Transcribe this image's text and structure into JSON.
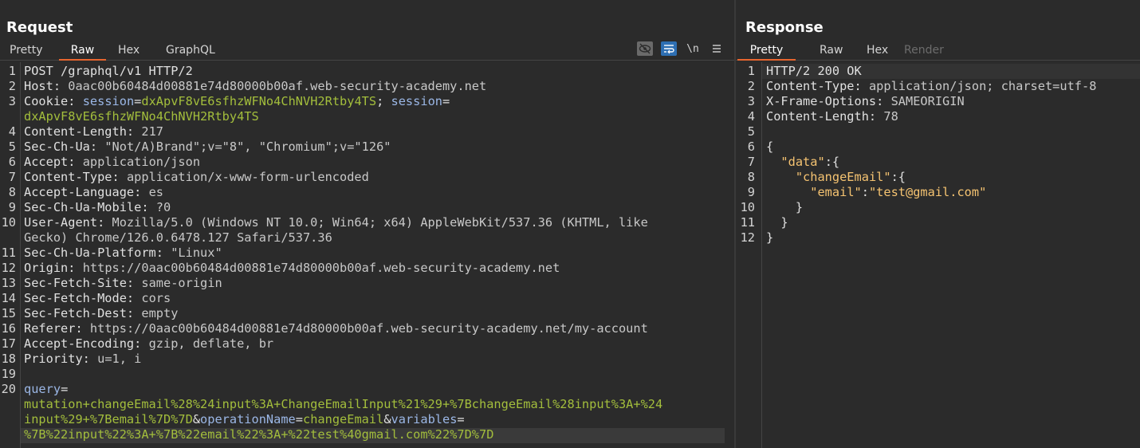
{
  "request": {
    "title": "Request",
    "tabs": [
      "Pretty",
      "Raw",
      "Hex",
      "GraphQL"
    ],
    "active_tab": "Raw",
    "toolbar": {
      "hide_icon": "eye-slash-icon",
      "wrap_icon": "wrap-icon",
      "newline_label": "\\n",
      "menu_icon": "menu-icon"
    },
    "lines": [
      {
        "n": "1",
        "parts": [
          {
            "t": "POST /graphql/v1 HTTP/2",
            "c": "hdr"
          }
        ]
      },
      {
        "n": "2",
        "parts": [
          {
            "t": "Host: ",
            "c": "hdr"
          },
          {
            "t": "0aac00b60484d00881e74d80000b00af.web-security-academy.net",
            "c": "val"
          }
        ]
      },
      {
        "n": "3",
        "parts": [
          {
            "t": "Cookie: ",
            "c": "hdr"
          },
          {
            "t": "session",
            "c": "blue"
          },
          {
            "t": "=",
            "c": "hdr"
          },
          {
            "t": "dxApvF8vE6sfhzWFNo4ChNVH2Rtby4TS",
            "c": "green"
          },
          {
            "t": "; ",
            "c": "hdr"
          },
          {
            "t": "session",
            "c": "blue"
          },
          {
            "t": "=",
            "c": "hdr"
          }
        ]
      },
      {
        "n": "",
        "parts": [
          {
            "t": "dxApvF8vE6sfhzWFNo4ChNVH2Rtby4TS",
            "c": "green"
          }
        ]
      },
      {
        "n": "4",
        "parts": [
          {
            "t": "Content-Length: ",
            "c": "hdr"
          },
          {
            "t": "217",
            "c": "val"
          }
        ]
      },
      {
        "n": "5",
        "parts": [
          {
            "t": "Sec-Ch-Ua: ",
            "c": "hdr"
          },
          {
            "t": "\"Not/A)Brand\";v=\"8\", \"Chromium\";v=\"126\"",
            "c": "val"
          }
        ]
      },
      {
        "n": "6",
        "parts": [
          {
            "t": "Accept: ",
            "c": "hdr"
          },
          {
            "t": "application/json",
            "c": "val"
          }
        ]
      },
      {
        "n": "7",
        "parts": [
          {
            "t": "Content-Type: ",
            "c": "hdr"
          },
          {
            "t": "application/x-www-form-urlencoded",
            "c": "val"
          }
        ]
      },
      {
        "n": "8",
        "parts": [
          {
            "t": "Accept-Language: ",
            "c": "hdr"
          },
          {
            "t": "es",
            "c": "val"
          }
        ]
      },
      {
        "n": "9",
        "parts": [
          {
            "t": "Sec-Ch-Ua-Mobile: ",
            "c": "hdr"
          },
          {
            "t": "?0",
            "c": "val"
          }
        ]
      },
      {
        "n": "10",
        "parts": [
          {
            "t": "User-Agent: ",
            "c": "hdr"
          },
          {
            "t": "Mozilla/5.0 (Windows NT 10.0; Win64; x64) AppleWebKit/537.36 (KHTML, like",
            "c": "val"
          }
        ]
      },
      {
        "n": "",
        "parts": [
          {
            "t": "Gecko) Chrome/126.0.6478.127 Safari/537.36",
            "c": "val"
          }
        ]
      },
      {
        "n": "11",
        "parts": [
          {
            "t": "Sec-Ch-Ua-Platform: ",
            "c": "hdr"
          },
          {
            "t": "\"Linux\"",
            "c": "val"
          }
        ]
      },
      {
        "n": "12",
        "parts": [
          {
            "t": "Origin: ",
            "c": "hdr"
          },
          {
            "t": "https://0aac00b60484d00881e74d80000b00af.web-security-academy.net",
            "c": "val"
          }
        ]
      },
      {
        "n": "13",
        "parts": [
          {
            "t": "Sec-Fetch-Site: ",
            "c": "hdr"
          },
          {
            "t": "same-origin",
            "c": "val"
          }
        ]
      },
      {
        "n": "14",
        "parts": [
          {
            "t": "Sec-Fetch-Mode: ",
            "c": "hdr"
          },
          {
            "t": "cors",
            "c": "val"
          }
        ]
      },
      {
        "n": "15",
        "parts": [
          {
            "t": "Sec-Fetch-Dest: ",
            "c": "hdr"
          },
          {
            "t": "empty",
            "c": "val"
          }
        ]
      },
      {
        "n": "16",
        "parts": [
          {
            "t": "Referer: ",
            "c": "hdr"
          },
          {
            "t": "https://0aac00b60484d00881e74d80000b00af.web-security-academy.net/my-account",
            "c": "val"
          }
        ]
      },
      {
        "n": "17",
        "parts": [
          {
            "t": "Accept-Encoding: ",
            "c": "hdr"
          },
          {
            "t": "gzip, deflate, br",
            "c": "val"
          }
        ]
      },
      {
        "n": "18",
        "parts": [
          {
            "t": "Priority: ",
            "c": "hdr"
          },
          {
            "t": "u=1, i",
            "c": "val"
          }
        ]
      },
      {
        "n": "19",
        "parts": []
      },
      {
        "n": "20",
        "parts": [
          {
            "t": "query",
            "c": "blue"
          },
          {
            "t": "=",
            "c": "hdr"
          }
        ]
      },
      {
        "n": "",
        "parts": [
          {
            "t": "mutation+changeEmail%28%24input%3A+ChangeEmailInput%21%29+%7BchangeEmail%28input%3A+%24",
            "c": "green"
          }
        ]
      },
      {
        "n": "",
        "parts": [
          {
            "t": "input%29+%7Bemail%7D%7D",
            "c": "green"
          },
          {
            "t": "&",
            "c": "hdr"
          },
          {
            "t": "operationName",
            "c": "blue"
          },
          {
            "t": "=",
            "c": "hdr"
          },
          {
            "t": "changeEmail",
            "c": "green"
          },
          {
            "t": "&",
            "c": "hdr"
          },
          {
            "t": "variables",
            "c": "blue"
          },
          {
            "t": "=",
            "c": "hdr"
          }
        ]
      },
      {
        "n": "",
        "parts": [
          {
            "t": "%7B%22input%22%3A+%7B%22email%22%3A+%22test%40gmail.com%22%7D%7D",
            "c": "green"
          }
        ]
      }
    ]
  },
  "response": {
    "title": "Response",
    "tabs": [
      "Pretty",
      "Raw",
      "Hex",
      "Render"
    ],
    "active_tab": "Pretty",
    "disabled_tab": "Render",
    "lines": [
      {
        "n": "1",
        "parts": [
          {
            "t": "HTTP/2 200 OK",
            "c": "hdr"
          }
        ]
      },
      {
        "n": "2",
        "parts": [
          {
            "t": "Content-Type: ",
            "c": "hdr"
          },
          {
            "t": "application/json; charset=utf-8",
            "c": "val"
          }
        ]
      },
      {
        "n": "3",
        "parts": [
          {
            "t": "X-Frame-Options: ",
            "c": "hdr"
          },
          {
            "t": "SAMEORIGIN",
            "c": "val"
          }
        ]
      },
      {
        "n": "4",
        "parts": [
          {
            "t": "Content-Length: ",
            "c": "hdr"
          },
          {
            "t": "78",
            "c": "val"
          }
        ]
      },
      {
        "n": "5",
        "parts": []
      },
      {
        "n": "6",
        "parts": [
          {
            "t": "{",
            "c": "hdr"
          }
        ]
      },
      {
        "n": "7",
        "parts": [
          {
            "t": "  ",
            "c": "hdr"
          },
          {
            "t": "\"data\"",
            "c": "jkey"
          },
          {
            "t": ":{",
            "c": "hdr"
          }
        ]
      },
      {
        "n": "8",
        "parts": [
          {
            "t": "    ",
            "c": "hdr"
          },
          {
            "t": "\"changeEmail\"",
            "c": "jkey"
          },
          {
            "t": ":{",
            "c": "hdr"
          }
        ]
      },
      {
        "n": "9",
        "parts": [
          {
            "t": "      ",
            "c": "hdr"
          },
          {
            "t": "\"email\"",
            "c": "jkey"
          },
          {
            "t": ":",
            "c": "hdr"
          },
          {
            "t": "\"test@gmail.com\"",
            "c": "jstr"
          }
        ]
      },
      {
        "n": "10",
        "parts": [
          {
            "t": "    }",
            "c": "hdr"
          }
        ]
      },
      {
        "n": "11",
        "parts": [
          {
            "t": "  }",
            "c": "hdr"
          }
        ]
      },
      {
        "n": "12",
        "parts": [
          {
            "t": "}",
            "c": "hdr"
          }
        ]
      }
    ]
  }
}
